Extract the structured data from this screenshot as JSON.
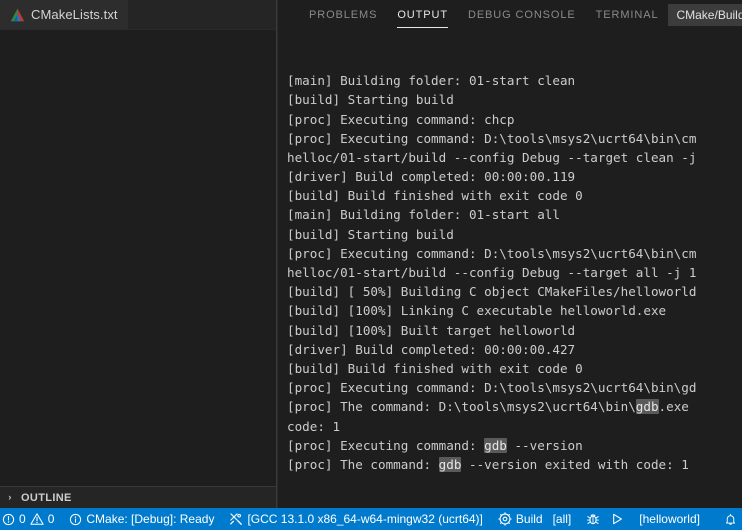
{
  "window": {
    "background": "#1e1e1e",
    "accent": "#007acc"
  },
  "sidebar": {
    "editor_tab": {
      "label": "CMakeLists.txt",
      "icon": "cmake-triangle-icon"
    },
    "outline": {
      "label": "OUTLINE",
      "chevron": "›"
    }
  },
  "panel": {
    "tabs": [
      {
        "label": "PROBLEMS",
        "active": false
      },
      {
        "label": "OUTPUT",
        "active": true
      },
      {
        "label": "DEBUG CONSOLE",
        "active": false
      },
      {
        "label": "TERMINAL",
        "active": false
      }
    ],
    "channel_selector": {
      "value": "CMake/Build",
      "icon": "chevron-down-icon"
    },
    "output_lines": [
      "[main] Building folder: 01-start clean",
      "[build] Starting build",
      "[proc] Executing command: chcp",
      "[proc] Executing command: D:\\tools\\msys2\\ucrt64\\bin\\cm",
      "helloc/01-start/build --config Debug --target clean -j",
      "[driver] Build completed: 00:00:00.119",
      "[build] Build finished with exit code 0",
      "[main] Building folder: 01-start all",
      "[build] Starting build",
      "[proc] Executing command: D:\\tools\\msys2\\ucrt64\\bin\\cm",
      "helloc/01-start/build --config Debug --target all -j 1",
      "[build] [ 50%] Building C object CMakeFiles/helloworld",
      "[build] [100%] Linking C executable helloworld.exe",
      "[build] [100%] Built target helloworld",
      "[driver] Build completed: 00:00:00.427",
      "[build] Build finished with exit code 0",
      "[proc] Executing command: D:\\tools\\msys2\\ucrt64\\bin\\gd",
      "[proc] The command: D:\\tools\\msys2\\ucrt64\\bin\\gdb.exe",
      "code: 1",
      "[proc] Executing command: gdb --version",
      "[proc] The command: gdb --version exited with code: 1"
    ],
    "search_highlight_term": "gdb"
  },
  "statusbar": {
    "problems": {
      "errors": "0",
      "warnings": "0",
      "error_icon": "error-circle-icon",
      "warning_icon": "warning-triangle-icon"
    },
    "cmake_status": {
      "label": "CMake: [Debug]: Ready",
      "icon": "info-circle-icon"
    },
    "kit": {
      "label": "[GCC 13.1.0 x86_64-w64-mingw32 (ucrt64)]",
      "icon": "tools-icon"
    },
    "build": {
      "label": "Build",
      "icon": "gear-icon"
    },
    "target": {
      "label": "[all]"
    },
    "debug": {
      "icon": "bug-icon"
    },
    "run": {
      "icon": "play-icon"
    },
    "launch_target": {
      "label": "[helloworld]"
    },
    "notification": {
      "icon": "bell-icon"
    }
  }
}
